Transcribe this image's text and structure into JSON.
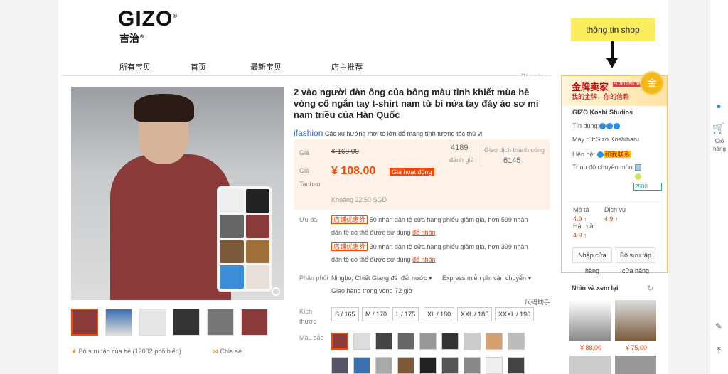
{
  "brand": {
    "logo": "GIZO",
    "registered": "®",
    "sub": "吉治",
    "sub_reg": "®"
  },
  "nav": [
    "所有宝贝",
    "首页",
    "最新宝贝",
    "店主推荐"
  ],
  "report_link": "Báo cáo",
  "product": {
    "title": "2 vào người đàn ông của bông màu tinh khiết mùa hè vòng cổ ngắn tay t-shirt nam từ bi nửa tay đáy áo sơ mi nam triều của Hàn Quốc",
    "ifashion_logo": "ifashion",
    "ifashion_text": "Các xu hướng mới to lớn để mang tính tương tác thú vị",
    "price_label": "Giá",
    "old_price": "¥ 168,00",
    "taobao_label_1": "Giá",
    "taobao_label_2": "Taobao",
    "new_price": "¥ 108.00",
    "price_tag": "Giá hoạt động",
    "rating_count": "4189",
    "rating_label": "đánh giá",
    "deals_label": "Giao dịch thành công",
    "deals_count": "6145",
    "approx_price": "Khoảng 22,50 SGD",
    "offer_label": "Ưu đãi",
    "offers": [
      {
        "tag": "店铺优惠券",
        "text_1": "50 nhân dân tệ cửa hàng phiếu giảm giá, hơn 599 nhân",
        "text_2": "dân tệ có thể được sử dụng",
        "link": "để nhận"
      },
      {
        "tag": "店铺优惠券",
        "text_1": "30 nhân dân tệ cửa hàng phiếu giảm giá, hơn 399 nhân",
        "text_2": "dân tệ có thể được sử dụng",
        "link": "để nhận"
      }
    ],
    "dist_label": "Phân phối",
    "dist_from": "Ningbo, Chiết Giang để",
    "dist_dest": "đất nước",
    "dist_ship": "Express miễn phí vận chuyển",
    "dist_time": "Giao hàng trong vòng 72 giờ",
    "size_help": "尺码助手",
    "size_label_1": "Kích",
    "size_label_2": "thước",
    "sizes": [
      "S / 165",
      "M / 170",
      "L / 175",
      "XL / 180",
      "XXL / 185",
      "XXXL / 190"
    ],
    "color_label": "Màu sắc",
    "collect": "Bộ sưu tập của bé (12002 phổ biến)",
    "share": "Chia sẻ"
  },
  "shop": {
    "gold_title": "金牌卖家",
    "gold_badge": "9 lần liên tiếp",
    "gold_sub": "我的金牌，你的信赖",
    "medal_char": "金",
    "name": "GIZO Koshi Studios",
    "credit_label": "Tín dụng:",
    "seller_label": "Máy rút:",
    "seller_name": "Gizo Koshiharu",
    "contact_label": "Liên hệ:",
    "contact_value": "和我联系",
    "expertise_label": "Trình độ chuyên môn:",
    "expertise_value": "2500",
    "scores": [
      {
        "label": "Mô tả",
        "value": "4.9 ↑"
      },
      {
        "label": "Dịch vụ",
        "value": "4.9 ↑"
      },
      {
        "label": "Hậu cần",
        "value": "4.9 ↑"
      }
    ],
    "btn_enter_1": "Nhập cửa",
    "btn_enter_2": "hàng",
    "btn_collect_1": "Bộ sưu tập",
    "btn_collect_2": "cửa hàng"
  },
  "callout": "thông tin shop",
  "recommend": {
    "title": "Nhìn và xem lại",
    "prices": [
      "¥ 88,00",
      "¥ 75,00"
    ]
  },
  "rail": {
    "cart_label_1": "Giỏ",
    "cart_label_2": "hàng"
  },
  "colors": {
    "accent": "#ff4400",
    "callout": "#fbec5d",
    "gold": "#f6b719"
  }
}
